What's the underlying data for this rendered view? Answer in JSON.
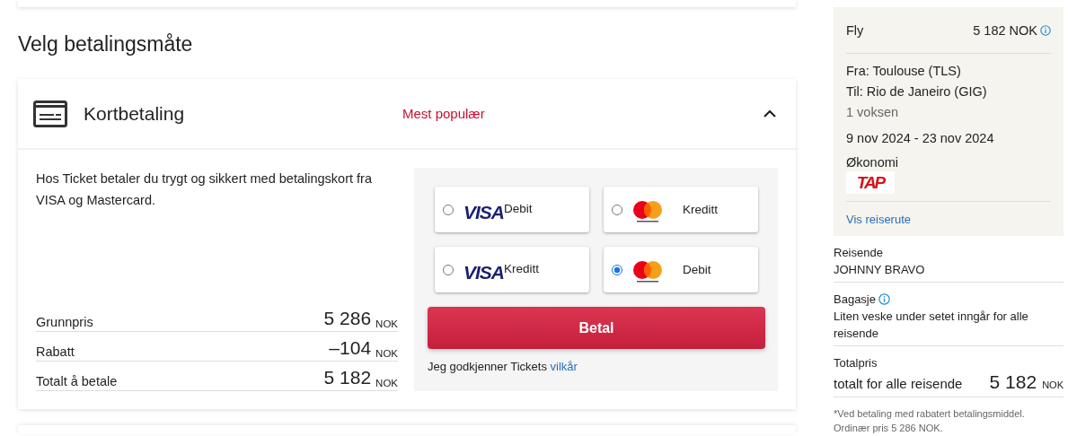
{
  "heading": "Velg betalingsmåte",
  "payment": {
    "title": "Kortbetaling",
    "badge": "Mest populær",
    "expanded": true,
    "description": "Hos Ticket betaler du trygt og sikkert med betalingskort fra VISA og Mastercard.",
    "price_rows": [
      {
        "label": "Grunnpris",
        "amount": "5 286",
        "currency": "NOK"
      },
      {
        "label": "Rabatt",
        "amount": "–104",
        "currency": "NOK"
      },
      {
        "label": "Totalt å betale",
        "amount": "5 182",
        "currency": "NOK"
      }
    ],
    "options": [
      {
        "kind": "visa",
        "brand": "VISA",
        "label": "Debit",
        "selected": false
      },
      {
        "kind": "mastercard",
        "label": "Kreditt",
        "selected": false
      },
      {
        "kind": "visa",
        "brand": "VISA",
        "label": "Kreditt",
        "selected": false
      },
      {
        "kind": "mastercard",
        "label": "Debit",
        "selected": true
      }
    ],
    "pay_button": "Betal",
    "terms_text": "Jeg godkjenner Tickets",
    "terms_link": "vilkår"
  },
  "summary": {
    "title": "Fly",
    "price": "5 182 NOK",
    "from": "Fra: Toulouse (TLS)",
    "to": "Til: Rio de Janeiro (GIG)",
    "passengers": "1 voksen",
    "dates": "9 nov 2024 - 23 nov 2024",
    "cabin": "Økonomi",
    "airline_logo": "TAP",
    "link": "Vis reiserute"
  },
  "traveler": {
    "label": "Reisende",
    "value": "JOHNNY BRAVO"
  },
  "baggage": {
    "label": "Bagasje",
    "value": "Liten veske under setet inngår for alle reisende"
  },
  "total": {
    "label": "Totalpris",
    "caption": "totalt for alle reisende",
    "amount": "5 182",
    "currency": "NOK"
  },
  "footnote": "*Ved betaling med rabatert betalingsmiddel. Ordinær pris 5 286 NOK."
}
